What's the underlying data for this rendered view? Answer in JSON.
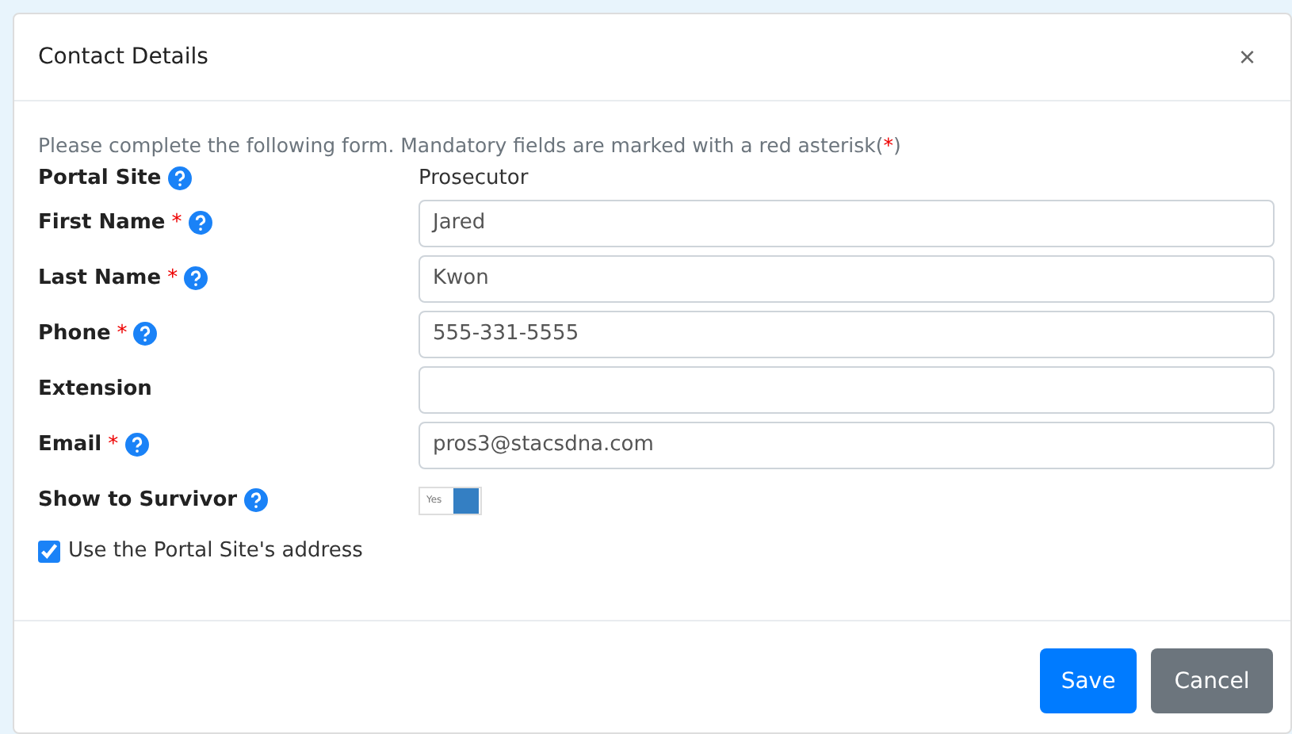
{
  "dialog": {
    "title": "Contact Details",
    "close": "×"
  },
  "intro": {
    "text": "Please complete the following form. Mandatory fields are marked with a red asterisk(",
    "mark": "*",
    "end": ")"
  },
  "fields": [
    {
      "kind": "text",
      "label": "Portal Site",
      "required": false,
      "help": true,
      "value": "Prosecutor"
    },
    {
      "kind": "input",
      "label": "First Name",
      "required": true,
      "help": true,
      "value": "Jared"
    },
    {
      "kind": "input",
      "label": "Last Name",
      "required": true,
      "help": true,
      "value": "Kwon"
    },
    {
      "kind": "input",
      "label": "Phone",
      "required": true,
      "help": true,
      "value": "555-331-5555"
    },
    {
      "kind": "input",
      "label": "Extension",
      "required": false,
      "help": false
    },
    {
      "kind": "input",
      "label": "Email",
      "required": true,
      "help": true,
      "value": "pros3@stacsdna.com"
    },
    {
      "kind": "toggle",
      "label": "Show to Survivor",
      "required": false,
      "help": true,
      "on": true,
      "on_label": "Yes"
    }
  ],
  "address_checkbox": {
    "label": "Use the Portal Site's address",
    "checked": true
  },
  "buttons": [
    {
      "kind": "primary",
      "label": "Save"
    },
    {
      "kind": "secondary",
      "label": "Cancel"
    }
  ]
}
